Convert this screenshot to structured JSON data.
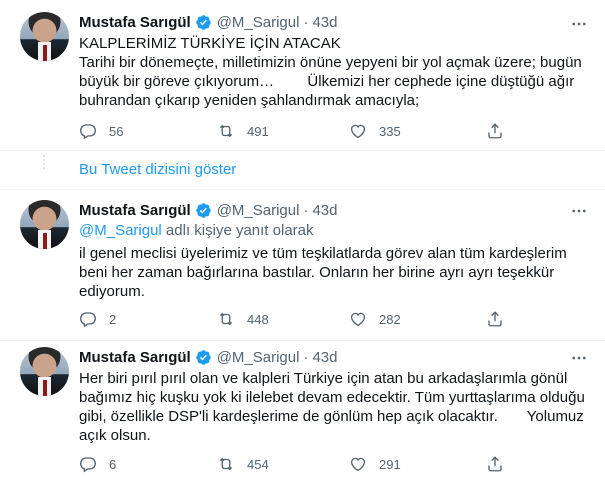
{
  "colors": {
    "accent": "#1d9bf0",
    "muted": "#536471",
    "text": "#0f1419",
    "verified": "#1d9bf0"
  },
  "show_thread": "Bu Tweet dizisini göster",
  "tweets": [
    {
      "name": "Mustafa Sarıgül",
      "handle": "@M_Sarigul",
      "separator": "·",
      "time": "43d",
      "lines": [
        "KALPLERİMİZ TÜRKİYE İÇİN ATACAK",
        "Tarihi bir dönemeçte, milletimizin önüne yepyeni bir yol açmak üzere; bugün",
        "büyük bir göreve çıkıyorum…        Ülkemizi her cephede içine düştüğü ağır",
        "buhrandan çıkarıp yeniden şahlandırmak amacıyla;"
      ],
      "replies": "56",
      "retweets": "491",
      "likes": "335"
    },
    {
      "name": "Mustafa Sarıgül",
      "handle": "@M_Sarigul",
      "separator": "·",
      "time": "43d",
      "reply_to_handle": "@M_Sarigul",
      "reply_to_suffix": " adlı kişiye yanıt olarak",
      "lines": [
        "il genel meclisi üyelerimiz ve tüm teşkilatlarda görev alan tüm kardeşlerim",
        "beni her zaman bağırlarına bastılar. Onların her birine ayrı ayrı teşekkür",
        "ediyorum."
      ],
      "replies": "2",
      "retweets": "448",
      "likes": "282"
    },
    {
      "name": "Mustafa Sarıgül",
      "handle": "@M_Sarigul",
      "separator": "·",
      "time": "43d",
      "lines": [
        "Her biri pırıl pırıl olan ve kalpleri Türkiye için atan bu arkadaşlarımla gönül",
        "bağımız hiç kuşku yok ki ilelebet devam edecektir. Tüm yurttaşlarıma olduğu",
        "gibi, özellikle DSP'li kardeşlerime de gönlüm hep açık olacaktır.       Yolumuz",
        "açık olsun."
      ],
      "replies": "6",
      "retweets": "454",
      "likes": "291"
    }
  ]
}
